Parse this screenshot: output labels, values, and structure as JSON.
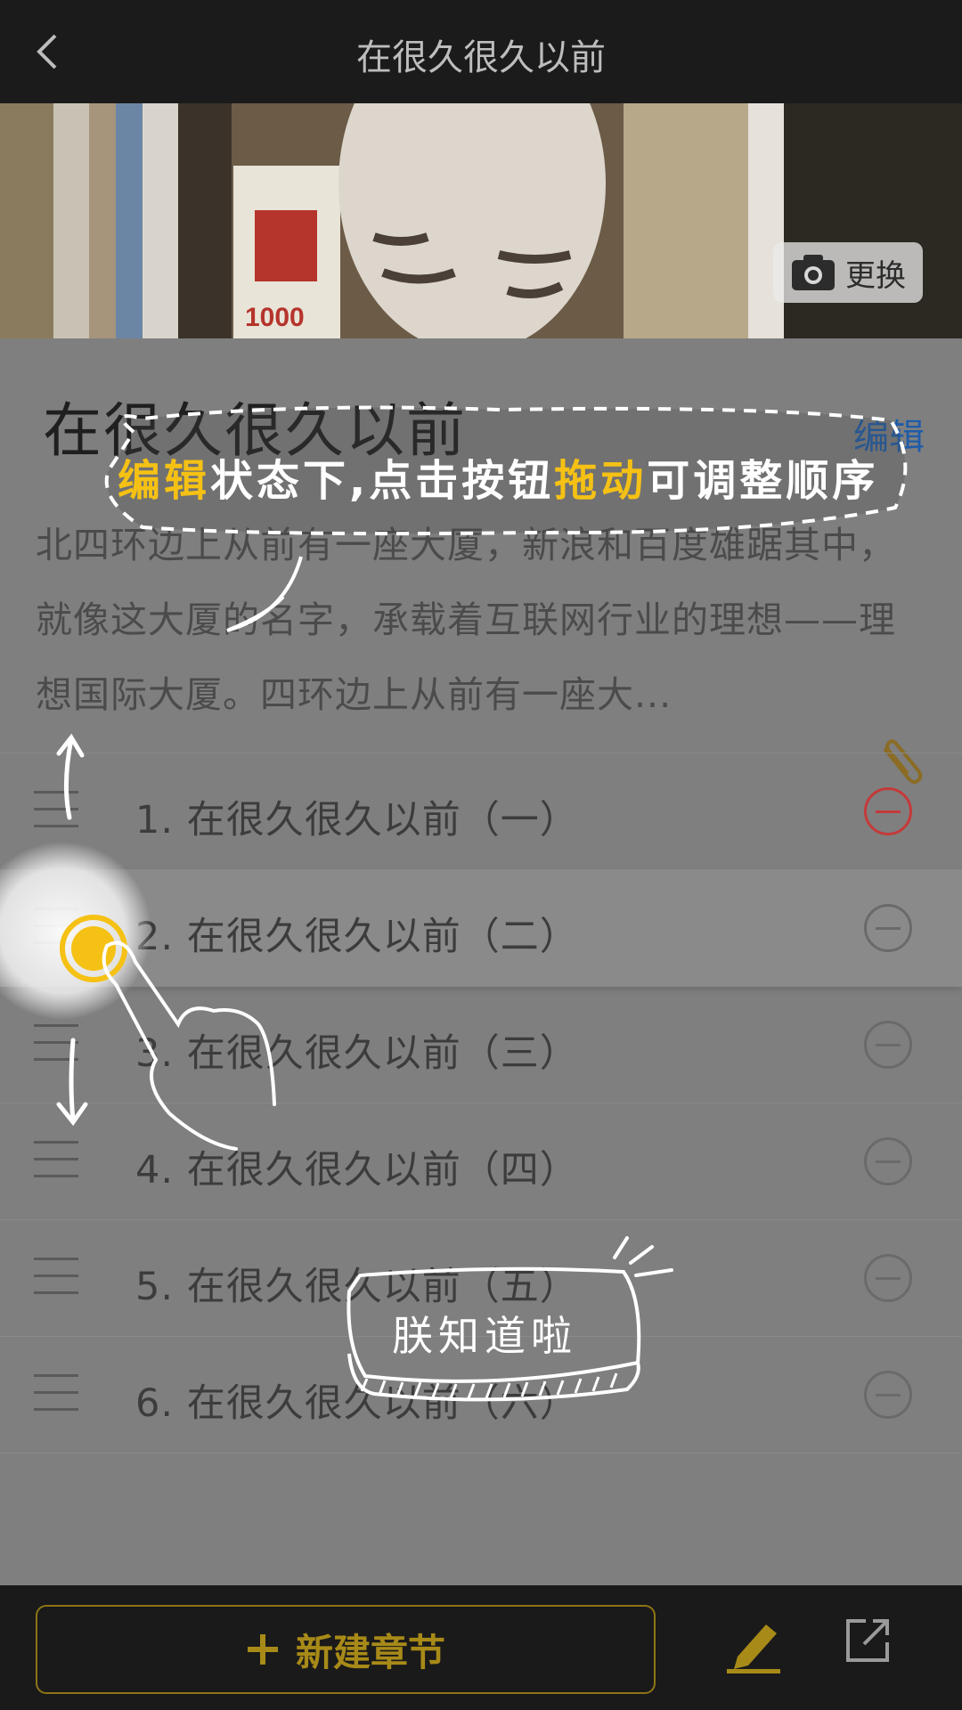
{
  "header": {
    "title": "在很久很久以前"
  },
  "cover": {
    "change_label": "更换"
  },
  "story": {
    "title": "在很久很久以前",
    "edit_label": "编辑",
    "description": "北四环边上从前有一座大厦，新浪和百度雄踞其中，就像这大厦的名字，承载着互联网行业的理想——理想国际大厦。四环边上从前有一座大..."
  },
  "chapters": [
    {
      "label": "1. 在很久很久以前（一）"
    },
    {
      "label": "2. 在很久很久以前（二）"
    },
    {
      "label": "3. 在很久很久以前（三）"
    },
    {
      "label": "4. 在很久很久以前（四）"
    },
    {
      "label": "5. 在很久很久以前（五）"
    },
    {
      "label": "6. 在很久很久以前（六）"
    }
  ],
  "bottom": {
    "new_chapter_label": "新建章节"
  },
  "tutorial": {
    "hint_prefix": "编辑",
    "hint_mid": "状态下,点击按钮",
    "hint_drag": "拖动",
    "hint_can": "可",
    "hint_suffix": "调整顺序",
    "ack_button": "朕知道啦"
  },
  "colors": {
    "accent": "#f5c114",
    "danger": "#c43a3a",
    "link": "#1f5ca8"
  }
}
